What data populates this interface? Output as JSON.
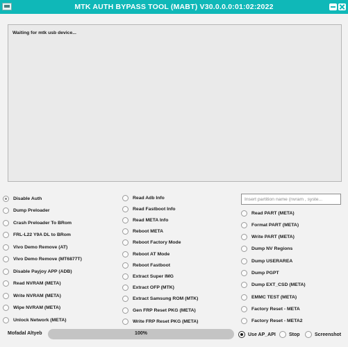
{
  "window": {
    "title": "MTK AUTH BYPASS TOOL (MABT) V30.0.0.0:01:02:2022"
  },
  "log": {
    "text": "Waiting for mtk usb device..."
  },
  "column1": [
    {
      "label": "Disable Auth",
      "selected": true
    },
    {
      "label": "Dump Preloader",
      "selected": false
    },
    {
      "label": "Crash Preloader To BRom",
      "selected": false
    },
    {
      "label": "FRL-L22 Y9A DL to BRom",
      "selected": false
    },
    {
      "label": "Vivo Demo Remove (AT)",
      "selected": false
    },
    {
      "label": "Vivo Demo Remove (MT6877T)",
      "selected": false
    },
    {
      "label": "Disable Payjoy APP (ADB)",
      "selected": false
    },
    {
      "label": "Read NVRAM (META)",
      "selected": false
    },
    {
      "label": "Write NVRAM (META)",
      "selected": false
    },
    {
      "label": "Wipe NVRAM (META)",
      "selected": false
    },
    {
      "label": "Unlock Network (META)",
      "selected": false
    }
  ],
  "column2": [
    {
      "label": "Read Adb Info",
      "selected": false
    },
    {
      "label": "Read Fastboot Info",
      "selected": false
    },
    {
      "label": "Read META Info",
      "selected": false
    },
    {
      "label": "Reboot META",
      "selected": false
    },
    {
      "label": "Reboot Factory Mode",
      "selected": false
    },
    {
      "label": "Reboot AT Mode",
      "selected": false
    },
    {
      "label": "Reboot Fastboot",
      "selected": false
    },
    {
      "label": "Extract Super IMG",
      "selected": false
    },
    {
      "label": "Extract OFP (MTK)",
      "selected": false
    },
    {
      "label": "Extract Samsung ROM (MTK)",
      "selected": false
    },
    {
      "label": "Gen FRP Reset PKG (META)",
      "selected": false
    },
    {
      "label": "Write FRP Reset PKG (META)",
      "selected": false
    }
  ],
  "column3": {
    "partition_placeholder": "Insert partition name (nvram , syste...",
    "partition_value": "",
    "items": [
      {
        "label": "Read PART (META)",
        "selected": false
      },
      {
        "label": "Format PART (META)",
        "selected": false
      },
      {
        "label": "Write PART (META)",
        "selected": false
      },
      {
        "label": "Dump NV Regions",
        "selected": false
      },
      {
        "label": "Dump USERAREA",
        "selected": false
      },
      {
        "label": "Dump PGPT",
        "selected": false
      },
      {
        "label": "Dump  EXT_CSD (META)",
        "selected": false
      },
      {
        "label": "EMMC TEST (META)",
        "selected": false
      },
      {
        "label": "Factory Reset - META",
        "selected": false
      },
      {
        "label": "Factory Reset - META2",
        "selected": false
      }
    ]
  },
  "footer": {
    "author": "Mofadal Altyeb",
    "progress_text": "100%",
    "progress_value": 100,
    "use_ap_api": {
      "label": "Use AP_API",
      "selected": true
    },
    "stop": {
      "label": "Stop",
      "selected": false
    },
    "screenshot": {
      "label": "Screenshot",
      "selected": false
    }
  },
  "colors": {
    "accent": "#0fb8b8",
    "background": "#f2f2f2"
  },
  "icons": {
    "app_logo": "app-logo-icon",
    "minimize": "minimize-icon",
    "close": "close-icon"
  }
}
